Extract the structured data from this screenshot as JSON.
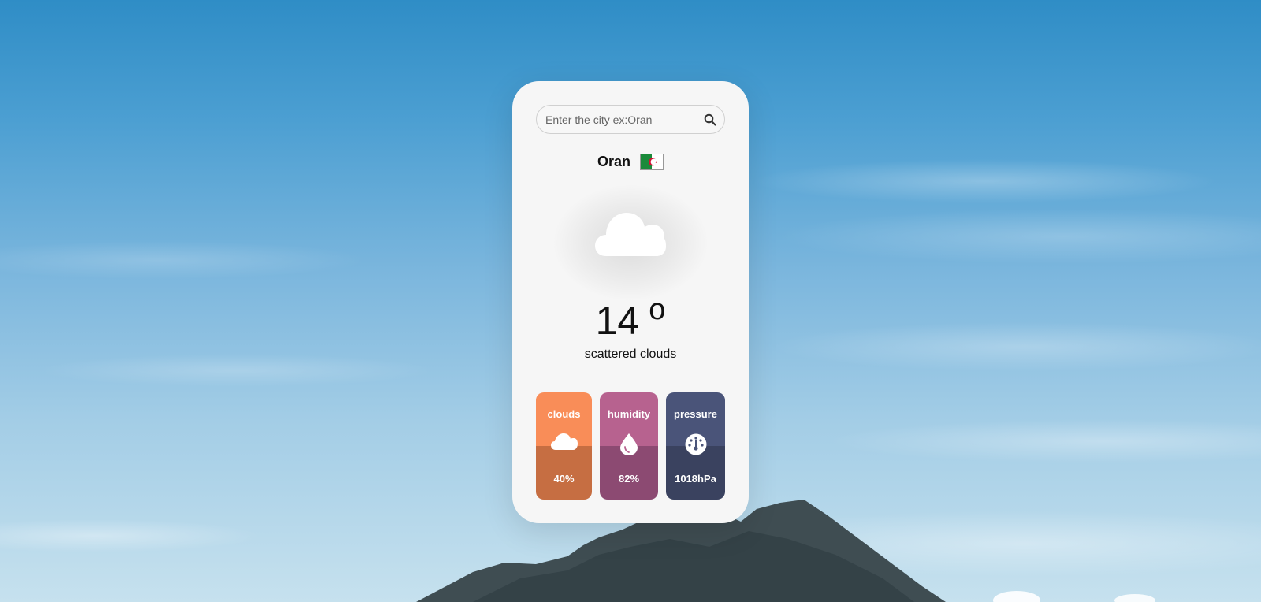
{
  "search": {
    "placeholder": "Enter the city ex:Oran",
    "value": ""
  },
  "location": {
    "city": "Oran",
    "country_flag": "algeria-flag"
  },
  "weather": {
    "icon": "cloud-icon",
    "temperature": "14",
    "unit": "o",
    "description": "scattered clouds"
  },
  "stats": [
    {
      "label": "clouds",
      "icon": "cloud-icon",
      "value": "40%",
      "top_color": "#f98d58",
      "bottom_color": "#c66e42"
    },
    {
      "label": "humidity",
      "icon": "water-drop-icon",
      "value": "82%",
      "top_color": "#b7628f",
      "bottom_color": "#8c4a72"
    },
    {
      "label": "pressure",
      "icon": "gauge-icon",
      "value": "1018hPa",
      "top_color": "#4a5479",
      "bottom_color": "#3a425f"
    }
  ]
}
